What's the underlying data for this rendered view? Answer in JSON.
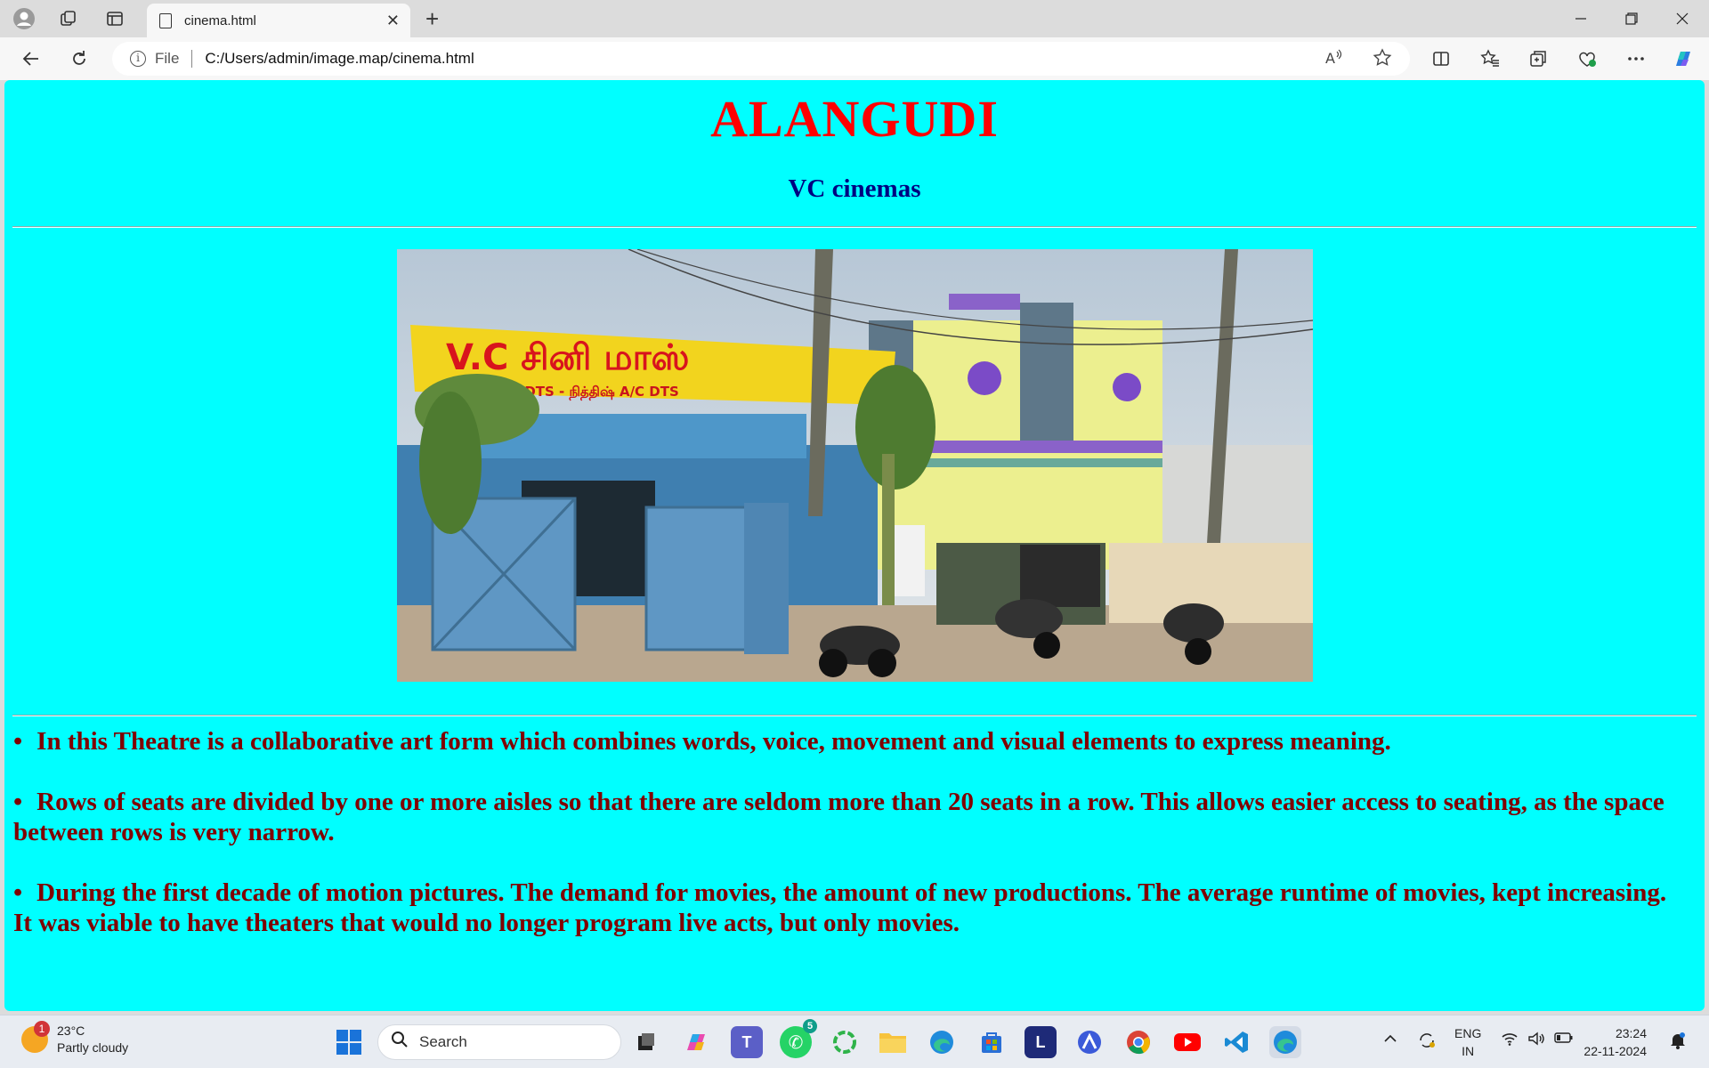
{
  "browser": {
    "tab_title": "cinema.html",
    "new_tab_symbol": "+",
    "close_tab_symbol": "✕",
    "address_prefix": "File",
    "url": "C:/Users/admin/image.map/cinema.html"
  },
  "page": {
    "heading": "ALANGUDI",
    "subheading": "VC cinemas",
    "photo": {
      "banner_text": "V.C சினி மாஸ்",
      "banner_subtext": "A/C DTS - நித்திஷ் A/C DTS"
    },
    "bullets": [
      "In this Theatre is a collaborative art form which combines words, voice, movement and visual elements to express meaning.",
      "Rows of seats are divided by one or more aisles so that there are seldom more than 20 seats in a row. This allows easier access to seating, as the space between rows is very narrow.",
      "During the first decade of motion pictures. The demand for movies, the amount of new productions. The average runtime of movies, kept increasing. It was viable to have theaters that would no longer program live acts, but only movies."
    ],
    "bullet_symbol": "•"
  },
  "taskbar": {
    "weather_temp": "23°C",
    "weather_desc": "Partly cloudy",
    "weather_badge": "1",
    "search_label": "Search",
    "lang_line1": "ENG",
    "lang_line2": "IN",
    "time": "23:24",
    "date": "22-11-2024",
    "whatsapp_badge": "5"
  },
  "colors": {
    "page_bg": "#00ffff",
    "heading": "#ff0000",
    "subheading": "#000080",
    "body_text": "#800000"
  }
}
